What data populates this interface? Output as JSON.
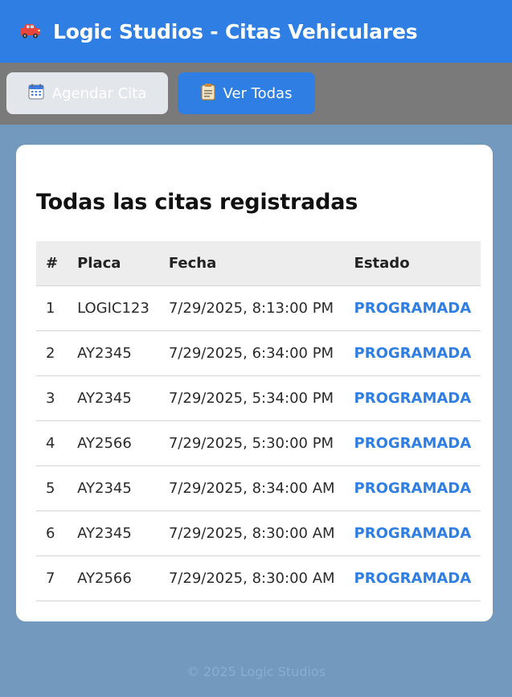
{
  "header": {
    "title": "Logic Studios - Citas Vehiculares",
    "icon": "car-icon"
  },
  "nav": {
    "agendar": {
      "label": "Agendar Cita",
      "icon": "calendar-icon"
    },
    "ver_todas": {
      "label": "Ver Todas",
      "icon": "clipboard-icon"
    }
  },
  "main": {
    "title": "Todas las citas registradas",
    "columns": [
      "#",
      "Placa",
      "Fecha",
      "Estado"
    ],
    "rows": [
      {
        "num": "1",
        "placa": "LOGIC123",
        "fecha": "7/29/2025, 8:13:00 PM",
        "estado": "PROGRAMADA"
      },
      {
        "num": "2",
        "placa": "AY2345",
        "fecha": "7/29/2025, 6:34:00 PM",
        "estado": "PROGRAMADA"
      },
      {
        "num": "3",
        "placa": "AY2345",
        "fecha": "7/29/2025, 5:34:00 PM",
        "estado": "PROGRAMADA"
      },
      {
        "num": "4",
        "placa": "AY2566",
        "fecha": "7/29/2025, 5:30:00 PM",
        "estado": "PROGRAMADA"
      },
      {
        "num": "5",
        "placa": "AY2345",
        "fecha": "7/29/2025, 8:34:00 AM",
        "estado": "PROGRAMADA"
      },
      {
        "num": "6",
        "placa": "AY2345",
        "fecha": "7/29/2025, 8:30:00 AM",
        "estado": "PROGRAMADA"
      },
      {
        "num": "7",
        "placa": "AY2566",
        "fecha": "7/29/2025, 8:30:00 AM",
        "estado": "PROGRAMADA"
      }
    ]
  },
  "footer": {
    "text": "© 2025 Logic Studios"
  },
  "colors": {
    "primary": "#2f7ee3",
    "page_background": "#7399bf",
    "nav_background": "#7a7a7a",
    "status": "#2f7ee3"
  }
}
